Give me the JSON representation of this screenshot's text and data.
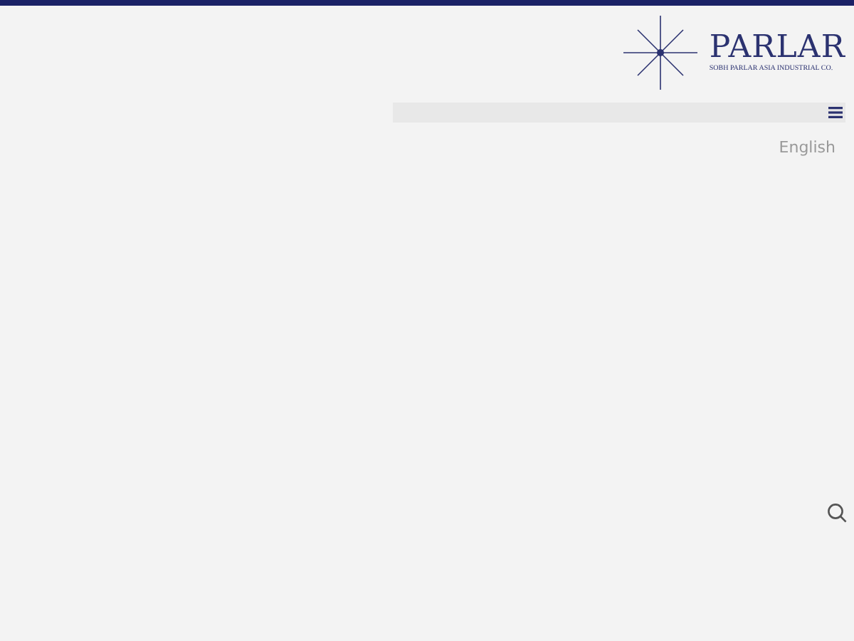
{
  "logo": {
    "name": "PARLAR",
    "tagline": "SOBH PARLAR ASIA INDUSTRIAL CO."
  },
  "language": "English"
}
